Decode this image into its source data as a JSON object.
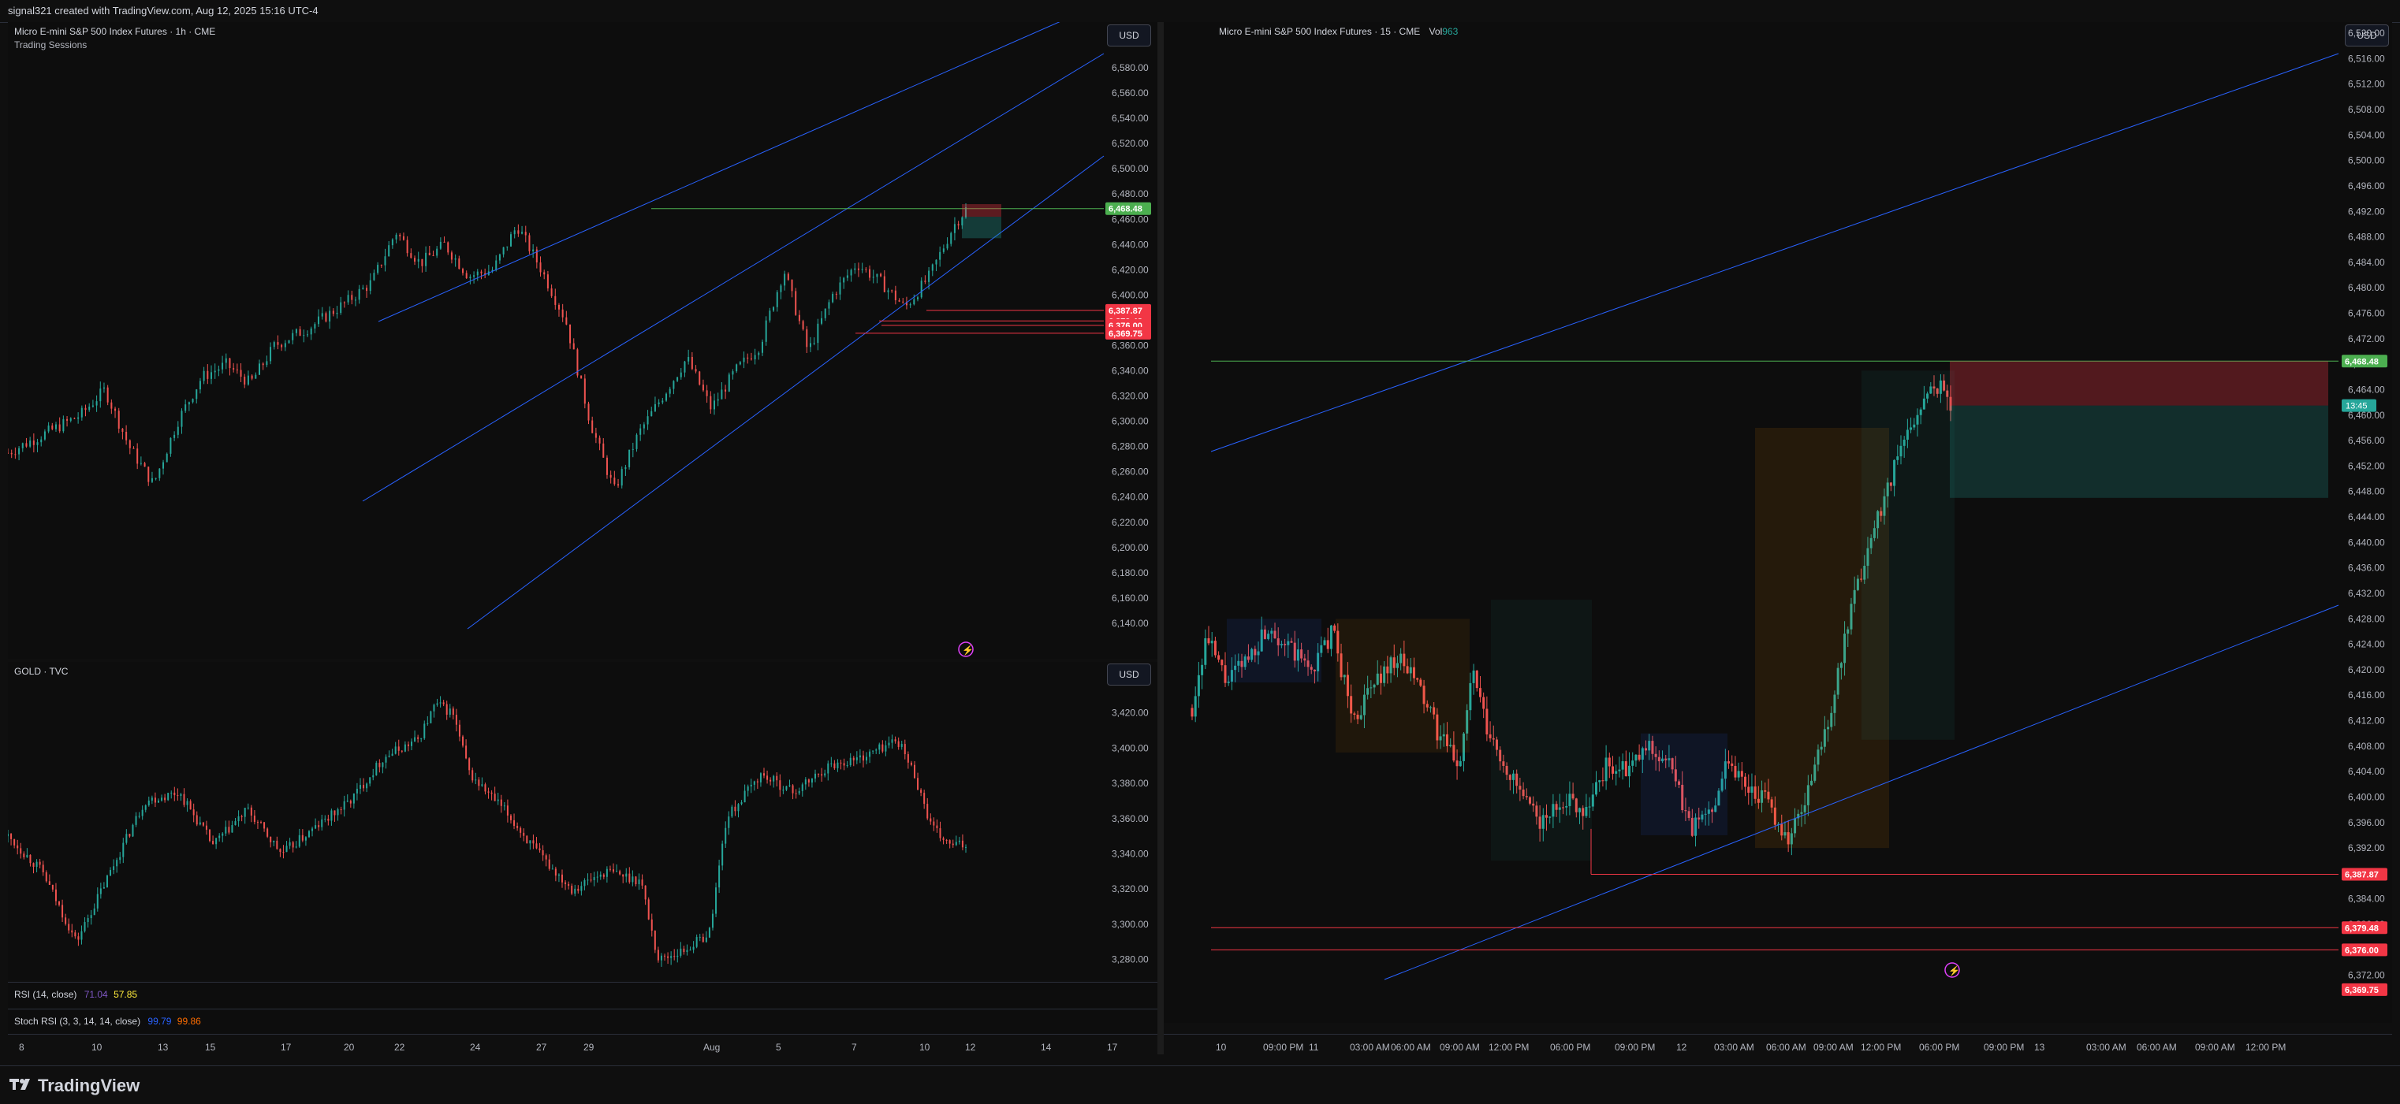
{
  "header": {
    "attribution": "signal321 created with TradingView.com, Aug 12, 2025 15:16 UTC-4"
  },
  "footer": {
    "brand": "TradingView"
  },
  "currency_label": "USD",
  "colors": {
    "up": "#26a69a",
    "down": "#ef5350",
    "trend": "#2962ff",
    "level_green": "#4caf50",
    "level_red": "#f23645",
    "bg": "#0d0d0d"
  },
  "icons": [
    "lightning-icon",
    "tradingview-logo-icon"
  ],
  "left": {
    "es_title": "Micro E-mini S&P 500 Index Futures · 1h · CME",
    "es_subtitle": "Trading Sessions",
    "gold_title": "GOLD · TVC",
    "rsi": {
      "label": "RSI (14, close)",
      "v1": "71.04",
      "v2": "57.85"
    },
    "stoch": {
      "label": "Stoch RSI (3, 3, 14, 14, close)",
      "v1": "99.79",
      "v2": "99.86"
    }
  },
  "right": {
    "title": "Micro E-mini S&P 500 Index Futures · 15 · CME",
    "vol_label": "Vol",
    "vol_value": "963",
    "countdown": "13:45"
  },
  "chart_data": [
    {
      "type": "candlestick",
      "title": "Micro E-mini S&P 500 Index Futures · 1h · CME",
      "ylim": [
        6120,
        6590
      ],
      "y_ticks": [
        "6,580.00",
        "6,560.00",
        "6,540.00",
        "6,520.00",
        "6,500.00",
        "6,480.00",
        "6,460.00",
        "6,440.00",
        "6,420.00",
        "6,400.00",
        "6,380.00",
        "6,360.00",
        "6,340.00",
        "6,320.00",
        "6,300.00",
        "6,280.00",
        "6,260.00",
        "6,240.00",
        "6,220.00",
        "6,200.00",
        "6,180.00",
        "6,160.00",
        "6,140.00"
      ],
      "x_labels": [
        "8",
        "10",
        "13",
        "15",
        "17",
        "20",
        "22",
        "24",
        "27",
        "29",
        "Aug",
        "5",
        "7",
        "10",
        "12",
        "14",
        "17"
      ],
      "price_path": [
        [
          0,
          6275
        ],
        [
          3,
          6290
        ],
        [
          6,
          6305
        ],
        [
          8,
          6325
        ],
        [
          10,
          6280
        ],
        [
          12,
          6250
        ],
        [
          14,
          6300
        ],
        [
          16,
          6335
        ],
        [
          18,
          6345
        ],
        [
          20,
          6330
        ],
        [
          22,
          6360
        ],
        [
          25,
          6375
        ],
        [
          28,
          6395
        ],
        [
          30,
          6410
        ],
        [
          32,
          6450
        ],
        [
          34,
          6425
        ],
        [
          36,
          6440
        ],
        [
          38,
          6415
        ],
        [
          40,
          6420
        ],
        [
          42,
          6455
        ],
        [
          44,
          6420
        ],
        [
          46,
          6380
        ],
        [
          48,
          6300
        ],
        [
          50,
          6245
        ],
        [
          52,
          6290
        ],
        [
          54,
          6320
        ],
        [
          56,
          6350
        ],
        [
          58,
          6310
        ],
        [
          60,
          6340
        ],
        [
          62,
          6360
        ],
        [
          64,
          6420
        ],
        [
          66,
          6355
        ],
        [
          68,
          6400
        ],
        [
          70,
          6425
        ],
        [
          72,
          6410
        ],
        [
          74,
          6390
        ],
        [
          76,
          6415
        ],
        [
          78,
          6455
        ],
        [
          79,
          6468
        ]
      ],
      "levels": [
        {
          "label": "6,468.48",
          "value": 6468.48,
          "color": "green"
        },
        {
          "label": "6,387.87",
          "value": 6387.87,
          "color": "red"
        },
        {
          "label": "6,379.48",
          "value": 6379.48,
          "color": "red"
        },
        {
          "label": "6,376.00",
          "value": 6376.0,
          "color": "red"
        },
        {
          "label": "6,369.75",
          "value": 6369.75,
          "color": "red"
        }
      ]
    },
    {
      "type": "candlestick",
      "title": "GOLD · TVC",
      "ylim": [
        3270,
        3440
      ],
      "y_ticks": [
        "3,420.00",
        "3,400.00",
        "3,380.00",
        "3,360.00",
        "3,340.00",
        "3,320.00",
        "3,300.00",
        "3,280.00"
      ],
      "price_path": [
        [
          0,
          3350
        ],
        [
          4,
          3330
        ],
        [
          8,
          3290
        ],
        [
          12,
          3330
        ],
        [
          16,
          3370
        ],
        [
          20,
          3375
        ],
        [
          24,
          3345
        ],
        [
          28,
          3365
        ],
        [
          32,
          3340
        ],
        [
          36,
          3355
        ],
        [
          40,
          3370
        ],
        [
          44,
          3395
        ],
        [
          48,
          3405
        ],
        [
          50,
          3425
        ],
        [
          52,
          3420
        ],
        [
          54,
          3385
        ],
        [
          58,
          3365
        ],
        [
          62,
          3340
        ],
        [
          66,
          3320
        ],
        [
          70,
          3330
        ],
        [
          74,
          3325
        ],
        [
          76,
          3280
        ],
        [
          79,
          3285
        ],
        [
          82,
          3295
        ],
        [
          84,
          3360
        ],
        [
          88,
          3385
        ],
        [
          92,
          3375
        ],
        [
          96,
          3390
        ],
        [
          100,
          3395
        ],
        [
          104,
          3405
        ],
        [
          106,
          3385
        ],
        [
          108,
          3355
        ],
        [
          110,
          3345
        ],
        [
          112,
          3345
        ]
      ]
    },
    {
      "type": "candlestick",
      "title": "Micro E-mini S&P 500 Index Futures · 15 · CME",
      "ylim": [
        6368,
        6521
      ],
      "y_ticks": [
        "6,520.00",
        "6,516.00",
        "6,512.00",
        "6,508.00",
        "6,504.00",
        "6,500.00",
        "6,496.00",
        "6,492.00",
        "6,488.00",
        "6,484.00",
        "6,480.00",
        "6,476.00",
        "6,472.00",
        "6,468.00",
        "6,464.00",
        "6,460.00",
        "6,456.00",
        "6,452.00",
        "6,448.00",
        "6,444.00",
        "6,440.00",
        "6,436.00",
        "6,432.00",
        "6,428.00",
        "6,424.00",
        "6,420.00",
        "6,416.00",
        "6,412.00",
        "6,408.00",
        "6,404.00",
        "6,400.00",
        "6,396.00",
        "6,392.00",
        "6,388.00",
        "6,384.00",
        "6,380.00",
        "6,376.00",
        "6,372.00"
      ],
      "x_labels": [
        "10",
        "09:00 PM",
        "11",
        "03:00 AM",
        "06:00 AM",
        "09:00 AM",
        "12:00 PM",
        "06:00 PM",
        "09:00 PM",
        "12",
        "03:00 AM",
        "06:00 AM",
        "09:00 AM",
        "12:00 PM",
        "06:00 PM",
        "09:00 PM",
        "13",
        "03:00 AM",
        "06:00 AM",
        "09:00 AM",
        "12:00 PM"
      ],
      "price_path": [
        [
          0,
          6414
        ],
        [
          2,
          6425
        ],
        [
          5,
          6418
        ],
        [
          8,
          6422
        ],
        [
          11,
          6427
        ],
        [
          14,
          6423
        ],
        [
          17,
          6420
        ],
        [
          20,
          6426
        ],
        [
          23,
          6412
        ],
        [
          26,
          6418
        ],
        [
          29,
          6422
        ],
        [
          32,
          6418
        ],
        [
          35,
          6410
        ],
        [
          38,
          6405
        ],
        [
          40,
          6420
        ],
        [
          42,
          6410
        ],
        [
          45,
          6404
        ],
        [
          48,
          6398
        ],
        [
          50,
          6396
        ],
        [
          53,
          6400
        ],
        [
          56,
          6398
        ],
        [
          59,
          6405
        ],
        [
          62,
          6404
        ],
        [
          65,
          6408
        ],
        [
          68,
          6405
        ],
        [
          71,
          6395
        ],
        [
          74,
          6398
        ],
        [
          76,
          6406
        ],
        [
          79,
          6402
        ],
        [
          82,
          6399
        ],
        [
          85,
          6393
        ],
        [
          88,
          6402
        ],
        [
          91,
          6414
        ],
        [
          94,
          6430
        ],
        [
          97,
          6442
        ],
        [
          100,
          6452
        ],
        [
          103,
          6460
        ],
        [
          106,
          6465
        ],
        [
          108,
          6462
        ]
      ],
      "levels": [
        {
          "label": "6,468.48",
          "value": 6468.48,
          "color": "green"
        },
        {
          "label": "6,387.87",
          "value": 6387.87,
          "color": "red"
        },
        {
          "label": "6,379.48",
          "value": 6379.48,
          "color": "red"
        },
        {
          "label": "6,376.00",
          "value": 6376.0,
          "color": "red"
        },
        {
          "label": "6,369.75",
          "value": 6369.75,
          "color": "red"
        }
      ]
    }
  ]
}
